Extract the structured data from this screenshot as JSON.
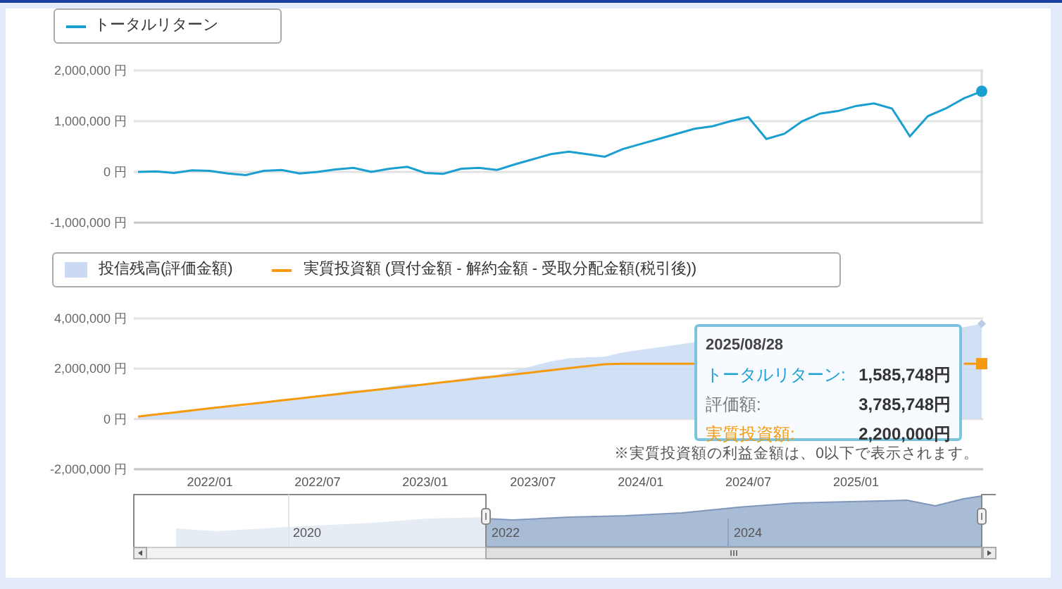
{
  "top_chart": {
    "chart_data": {
      "type": "line",
      "categories": [
        null,
        null,
        null,
        null,
        null,
        null,
        null,
        null,
        null,
        null,
        null,
        null,
        null,
        null,
        null,
        null,
        null,
        null,
        null,
        null,
        null,
        null,
        null,
        null,
        null,
        null,
        null,
        null,
        null,
        null,
        null,
        null,
        null,
        null,
        null,
        null,
        null,
        null,
        null,
        null,
        null,
        null,
        null,
        null,
        null,
        null,
        null,
        null
      ],
      "ylim": [
        -1000000,
        2000000
      ],
      "yticks": [
        {
          "value": 2000000,
          "label": "2,000,000 円"
        },
        {
          "value": 1000000,
          "label": "1,000,000 円"
        },
        {
          "value": 0,
          "label": "0 円"
        },
        {
          "value": -1000000,
          "label": "-1,000,000 円"
        }
      ],
      "series": [
        {
          "name": "トータルリターン",
          "color": "#1a9fd0",
          "values": [
            0,
            10000,
            -20000,
            30000,
            20000,
            -30000,
            -60000,
            20000,
            40000,
            -30000,
            0,
            50000,
            80000,
            0,
            60000,
            100000,
            -20000,
            -40000,
            60000,
            80000,
            40000,
            150000,
            250000,
            350000,
            400000,
            350000,
            300000,
            450000,
            550000,
            650000,
            750000,
            850000,
            900000,
            1000000,
            1080000,
            650000,
            750000,
            1000000,
            1150000,
            1200000,
            1300000,
            1350000,
            1250000,
            700000,
            1100000,
            1250000,
            1450000,
            1590000
          ]
        }
      ]
    }
  },
  "bottom_chart": {
    "chart_data": {
      "type": "area",
      "categories": [
        null,
        null,
        null,
        null,
        "2022/01",
        null,
        null,
        null,
        null,
        null,
        "2022/07",
        null,
        null,
        null,
        null,
        null,
        "2023/01",
        null,
        null,
        null,
        null,
        null,
        "2023/07",
        null,
        null,
        null,
        null,
        null,
        "2024/01",
        null,
        null,
        null,
        null,
        null,
        "2024/07",
        null,
        null,
        null,
        null,
        null,
        "2025/01",
        null,
        null,
        null,
        null,
        null,
        null,
        null
      ],
      "ylim": [
        -2000000,
        4000000
      ],
      "yticks": [
        {
          "value": 4000000,
          "label": "4,000,000 円"
        },
        {
          "value": 2000000,
          "label": "2,000,000 円"
        },
        {
          "value": 0,
          "label": "0 円"
        },
        {
          "value": -2000000,
          "label": "-2,000,000 円"
        }
      ],
      "series": [
        {
          "name": "投信残高(評価金額)",
          "color": "#c9daf2",
          "values": [
            100000,
            190000,
            240000,
            370000,
            440000,
            470000,
            520000,
            680000,
            780000,
            790000,
            900000,
            1030000,
            1140000,
            1140000,
            1280000,
            1400000,
            1360000,
            1420000,
            1600000,
            1700000,
            1740000,
            1930000,
            2110000,
            2290000,
            2420000,
            2450000,
            2480000,
            2650000,
            2750000,
            2850000,
            2950000,
            3050000,
            null,
            null,
            null,
            null,
            null,
            null,
            null,
            null,
            null,
            null,
            null,
            null,
            null,
            null,
            3650000,
            3790000
          ]
        },
        {
          "name": "実質投資額 (買付金額 - 解約金額 - 受取分配金額(税引後))",
          "type": "line",
          "color": "#f59a0c",
          "values": [
            100000,
            180000,
            260000,
            340000,
            420000,
            500000,
            580000,
            660000,
            740000,
            820000,
            900000,
            980000,
            1060000,
            1140000,
            1220000,
            1300000,
            1380000,
            1460000,
            1540000,
            1620000,
            1700000,
            1780000,
            1860000,
            1940000,
            2020000,
            2100000,
            2180000,
            2200000,
            2200000,
            2200000,
            2200000,
            2200000,
            null,
            null,
            null,
            null,
            null,
            null,
            null,
            null,
            null,
            null,
            null,
            null,
            null,
            null,
            2200000,
            2200000
          ]
        }
      ]
    },
    "note": "※実質投資額の利益金額は、0以下で表示されます。",
    "tooltip": {
      "date": "2025/08/28",
      "rows": [
        {
          "label": "トータルリターン:",
          "value": "1,585,748円",
          "color": "#1a9fd0"
        },
        {
          "label": "評価額:",
          "value": "3,785,748円",
          "color": "#777777"
        },
        {
          "label": "実質投資額:",
          "value": "2,200,000円",
          "color": "#f59a0c"
        }
      ]
    }
  },
  "navigator": {
    "labels": [
      "2020",
      "2022",
      "2024"
    ]
  }
}
